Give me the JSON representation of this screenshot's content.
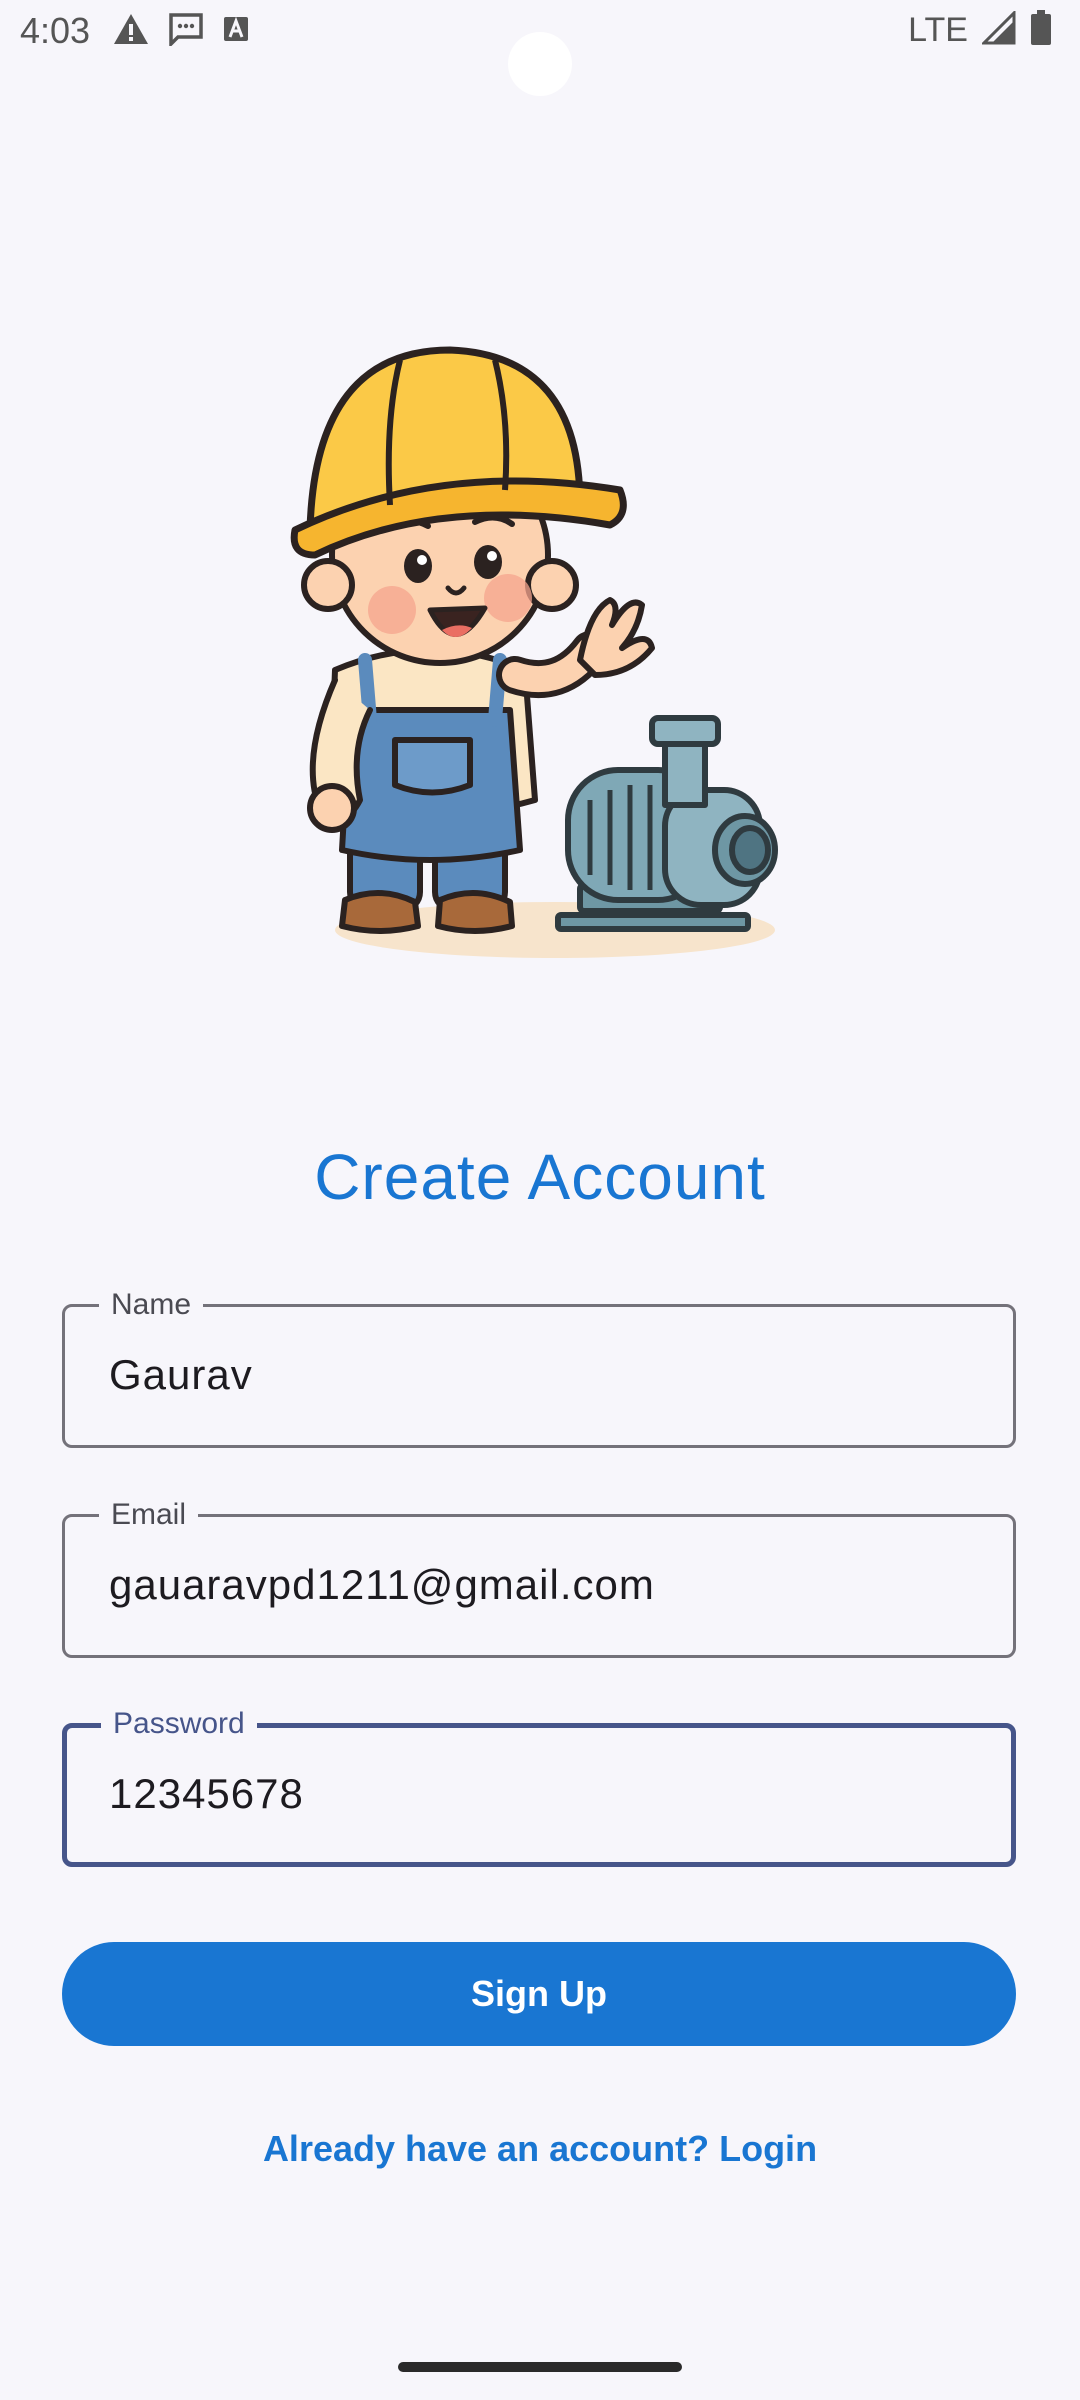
{
  "status_bar": {
    "time": "4:03",
    "network": "LTE",
    "icons_left": [
      "warning-icon",
      "message-icon",
      "keyboard-a-icon"
    ],
    "icons_right": [
      "signal-icon",
      "battery-icon"
    ]
  },
  "illustration": {
    "description_icon": "worker-with-pump-illustration"
  },
  "title": "Create Account",
  "form": {
    "name": {
      "label": "Name",
      "value": "Gaurav"
    },
    "email": {
      "label": "Email",
      "value": "gauaravpd1211@gmail.com"
    },
    "password": {
      "label": "Password",
      "value": "12345678"
    }
  },
  "signup_button": "Sign Up",
  "login_link": "Already have an account? Login",
  "colors": {
    "accent": "#1976d2",
    "focused_border": "#46558a",
    "background": "#f7f6fb"
  }
}
